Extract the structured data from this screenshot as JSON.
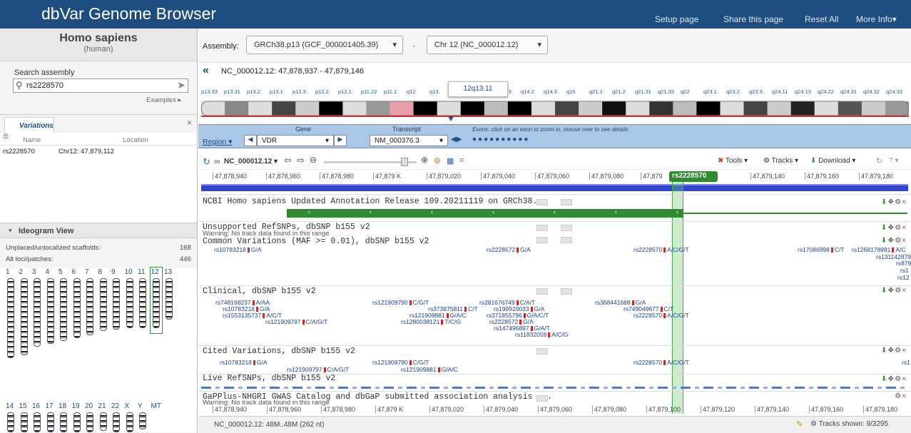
{
  "header": {
    "title": "dbVar Genome Browser",
    "links": [
      "Setup page",
      "Share this page",
      "Reset All",
      "More Info▾"
    ]
  },
  "organism": {
    "name": "Homo sapiens",
    "common": "(human)"
  },
  "search": {
    "label": "Search assembly",
    "value": "rs2228570",
    "examples": "Examples ▸"
  },
  "variations": {
    "tab": "Variations",
    "col_name": "Name",
    "col_location": "Location",
    "rows": [
      {
        "name": "rs2228570",
        "location": "Chr12: 47,879,112"
      }
    ]
  },
  "ideogram": {
    "title": "Ideogram View",
    "unplaced_label": "Unplaced/unlocalized scaffolds:",
    "unplaced_count": "168",
    "alt_label": "Alt loci/patches:",
    "alt_count": "446",
    "chroms_row1": [
      "1",
      "2",
      "3",
      "4",
      "5",
      "6",
      "7",
      "8",
      "9",
      "10",
      "11",
      "12",
      "13"
    ],
    "chroms_row2": [
      "14",
      "15",
      "16",
      "17",
      "18",
      "19",
      "20",
      "21",
      "22",
      "X",
      "Y",
      "MT"
    ],
    "selected": "12"
  },
  "assembly": {
    "label": "Assembly:",
    "value": "GRCh38.p13 (GCF_000001405.39)",
    "chr": "Chr 12 (NC_000012.12)"
  },
  "location_bar": {
    "text": "NC_000012.12: 47,878,937 - 47,879,146"
  },
  "cyto_bands": [
    "p13.33",
    "p13.31",
    "p13.2",
    "p13.1",
    "p12.3",
    "p12.2",
    "p12.1",
    "p11.22",
    "p11.1",
    "q12",
    "q13.",
    "12q13.11",
    "13.2",
    "q13.3",
    "q14.2",
    "q14.3",
    "q15",
    "q21.1",
    "q21.2",
    "q21.31",
    "q21.33",
    "q22",
    "q23.1",
    "q23.2",
    "q23.3",
    "q24.11",
    "q24.13",
    "q24.22",
    "q24.31",
    "q24.32",
    "q24.33"
  ],
  "cyto_popup": "12q13.11",
  "region_panel": {
    "region": "Region ▾",
    "gene_label": "Gene",
    "gene": "VDR",
    "transcript_label": "Transcript",
    "transcript": "NM_000376.3",
    "exons_hint": "Exons: click on an exon to zoom in, mouse over to see details"
  },
  "toolbar": {
    "seq": "NC_000012.12 ▾",
    "tools": "Tools ▾",
    "tracks": "Tracks ▾",
    "download": "Download ▾",
    "help": "? ▾"
  },
  "ruler": [
    "47,878,940",
    "47,878,960",
    "47,878,980",
    "47,879 K",
    "47,879,020",
    "47,879,040",
    "47,879,060",
    "47,879,080",
    "47,879",
    "rs2228570",
    "120",
    "47,879,140",
    "47,879,160",
    "47,879,180"
  ],
  "ruler_bottom": [
    "47,878,940",
    "47,878,960",
    "47,878,980",
    "47,879 K",
    "47,879,020",
    "47,879,040",
    "47,879,060",
    "47,879,080",
    "47,879,100",
    "47,879,120",
    "47,879,140",
    "47,879,160",
    "47,879,180"
  ],
  "tracks": {
    "ncbi": "NCBI Homo sapiens Updated Annotation Release 109.20211119 on GRCh38...",
    "unsupported": "Unsupported RefSNPs, dbSNP b155 v2",
    "warning": "Warning: No track data found in this range",
    "common": "Common Variations (MAF >= 0.01), dbSNP b155 v2",
    "clinical": "Clinical, dbSNP b155 v2",
    "cited": "Cited Variations, dbSNP b155 v2",
    "live": "Live RefSNPs, dbSNP b155 v2",
    "gaplus": "GaPPlus-NHGRI GWAS Catalog and dbGaP submitted association analysis ..."
  },
  "common_vars": [
    [
      "rs10783218",
      "G/A"
    ],
    [
      "rs2228572",
      "G/A"
    ],
    [
      "rs2228570",
      "A/C/G/T"
    ],
    [
      "rs17086998",
      "C/T"
    ],
    [
      "rs1268178981",
      "A/C"
    ],
    [
      "rs1311428794",
      ""
    ],
    [
      "rs879",
      ""
    ],
    [
      "rs1",
      ""
    ],
    [
      "rs12",
      ""
    ]
  ],
  "clinical_vars": [
    [
      "rs748168237",
      "A/AA"
    ],
    [
      "rs121909790",
      "C/G/T"
    ],
    [
      "rs281676749",
      "C/A/T"
    ],
    [
      "rs368441688",
      "G/A"
    ],
    [
      "rs10783218",
      "G/A"
    ],
    [
      "rs373875811",
      "C/T"
    ],
    [
      "rs199929033",
      "G/A"
    ],
    [
      "rs749049677",
      "C/T"
    ],
    [
      "rs1553135737",
      "A/C/T"
    ],
    [
      "rs121909881",
      "G/A/C"
    ],
    [
      "rs371855796",
      "G/A/C/T"
    ],
    [
      "rs2228570",
      "A/C/G/T"
    ],
    [
      "rs121909797",
      "C/A/G/T"
    ],
    [
      "rs1280038121",
      "T/C/G"
    ],
    [
      "rs2228572",
      "G/A"
    ],
    [
      "rs147496897",
      "G/A/T"
    ],
    [
      "rs11832059",
      "A/C/G"
    ]
  ],
  "cited_vars": [
    [
      "rs10783218",
      "G/A"
    ],
    [
      "rs121909790",
      "C/G/T"
    ],
    [
      "rs2228570",
      "A/C/G/T"
    ],
    [
      "rs121909797",
      "C/A/G/T"
    ],
    [
      "rs121909881",
      "G/A/C"
    ],
    [
      "rs1",
      ""
    ]
  ],
  "status": {
    "left": "NC_000012.12: 48M..48M (262 nt)",
    "right": "Tracks shown: 9/3295"
  },
  "colors": {
    "header": "#1e4d80",
    "gene": "#2e8b2e",
    "highlight": "#7fd07f",
    "seq_bar": "#3344cc"
  }
}
